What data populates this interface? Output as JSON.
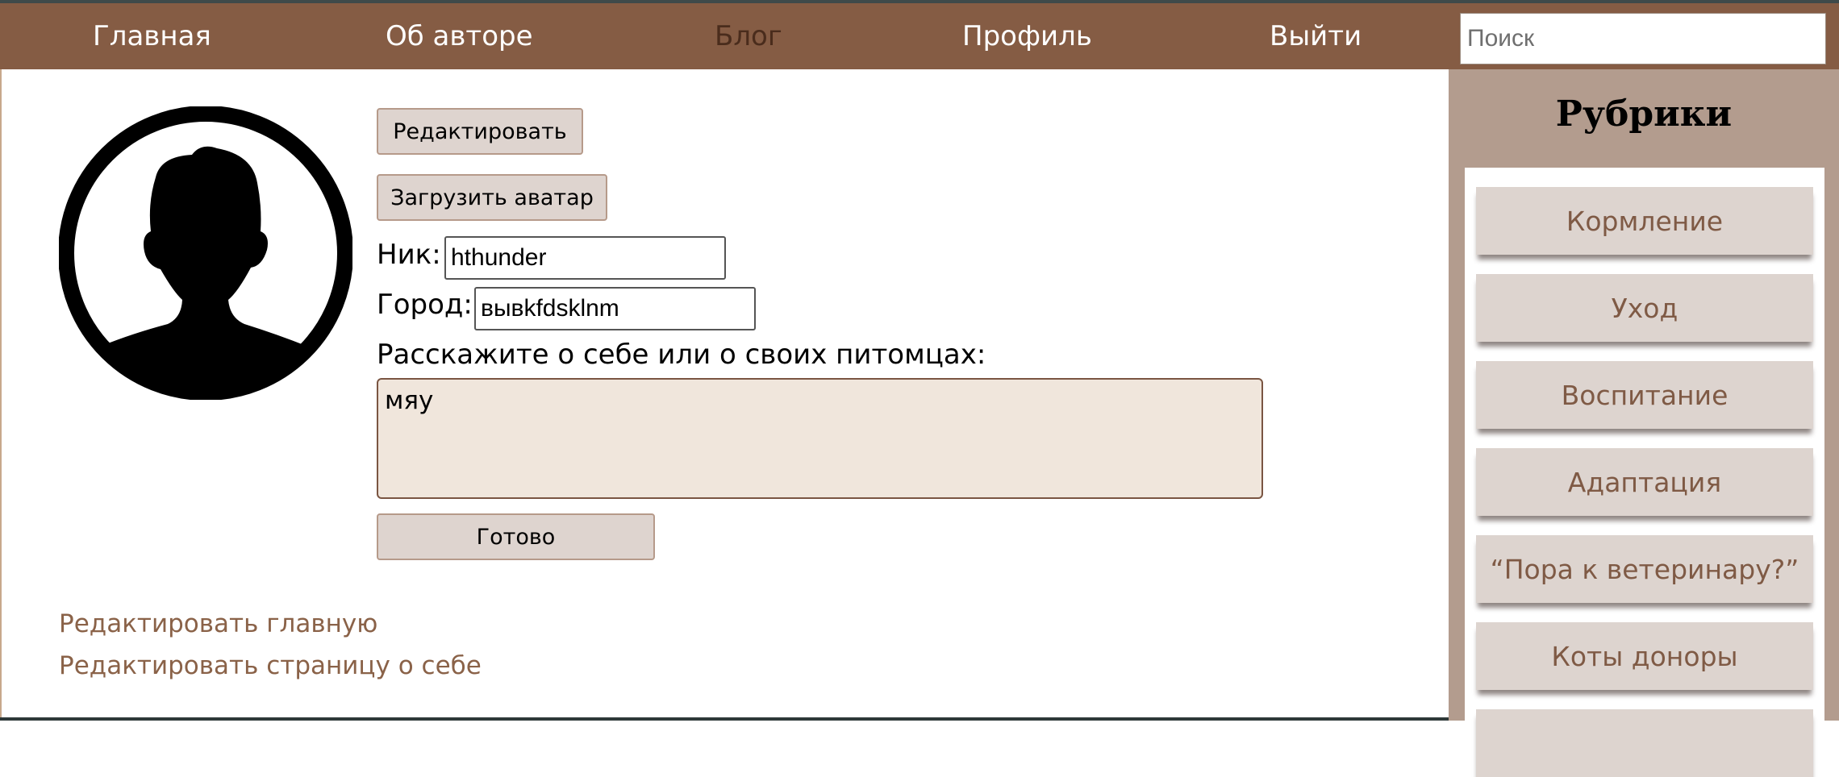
{
  "nav": {
    "items": [
      "Главная",
      "Об авторе",
      "Блог",
      "Профиль",
      "Выйти"
    ],
    "active_item": "Блог",
    "search_placeholder": "Поиск"
  },
  "profile": {
    "edit_button": "Редактировать",
    "upload_avatar_button": "Загрузить аватар",
    "nick_label": "Ник:",
    "nick_value": "hthunder",
    "city_label": "Город:",
    "city_value": "вывkfdsklnm",
    "about_label": "Расскажите о себе или о своих питомцах:",
    "about_value": "мяу",
    "done_button": "Готово"
  },
  "admin_links": [
    "Редактировать главную",
    "Редактировать страницу о себе"
  ],
  "sidebar": {
    "title": "Рубрики",
    "categories": [
      "Кормление",
      "Уход",
      "Воспитание",
      "Адаптация",
      "“Пора к ветеринару?”",
      "Коты доноры"
    ]
  },
  "icons": {
    "avatar": "user-silhouette-icon"
  },
  "colors": {
    "header_bg": "#855c44",
    "sidebar_bg": "#b39c8e",
    "button_bg": "#ded4cf",
    "link_color": "#8a6248",
    "textarea_bg": "#f0e6dc"
  }
}
